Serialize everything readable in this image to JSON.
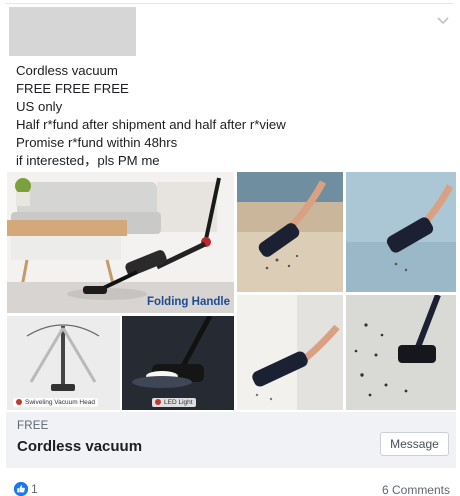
{
  "post": {
    "lines": [
      "Cordless vacuum",
      "FREE FREE FREE",
      "US only",
      "Half r*fund after shipment and half after r*view",
      "Promise r*fund within 48hrs",
      "if interested，pls PM me"
    ]
  },
  "gallery": {
    "main_caption": "Folding Handle",
    "caption_swivel": "Swiveling Vacuum Head",
    "caption_led": "LED Light"
  },
  "listing": {
    "price": "FREE",
    "title": "Cordless vacuum",
    "message_label": "Message"
  },
  "footer": {
    "reaction_count": "1",
    "comments_label": "6 Comments"
  },
  "colors": {
    "accent": "#1877f2",
    "listing_bg": "#f0f2f5",
    "caption_blue": "#1f4b93"
  }
}
